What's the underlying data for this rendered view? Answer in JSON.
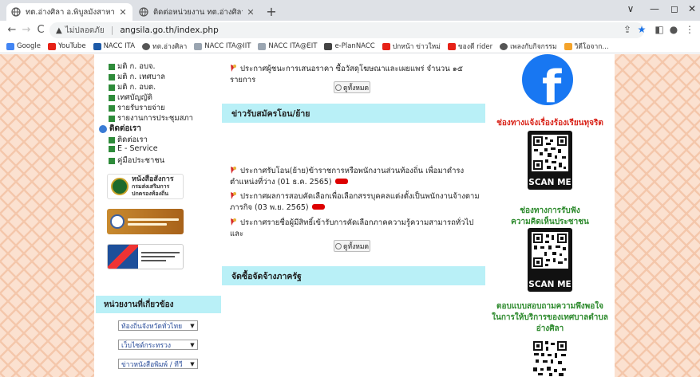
{
  "browser": {
    "tabs": [
      {
        "title": "ทต.อ่างศิลา อ.พิบูลมังสาหาร จ.อุบลราชธานี",
        "active": true
      },
      {
        "title": "ติดต่อหน่วยงาน ทต.อ่างศิลา อ.พิบูลมังสาหาร",
        "active": false
      }
    ],
    "new_tab": "+",
    "window_controls": {
      "minimize": "—",
      "maximize": "◻",
      "close": "✕",
      "menu": "∨"
    },
    "nav": {
      "back": "←",
      "forward": "→",
      "reload": "C"
    },
    "address": {
      "insecure_label": "ไม่ปลอดภัย",
      "separator": "|",
      "url": "angsila.go.th/index.php"
    },
    "bookmarks": [
      {
        "label": "Google",
        "color": "#4285f4"
      },
      {
        "label": "YouTube",
        "color": "#e62117"
      },
      {
        "label": "NACC ITA",
        "color": "#1d5aa8"
      },
      {
        "label": "ทต.อ่างศิลา",
        "color": "#555555"
      },
      {
        "label": "NACC ITA@IIT",
        "color": "#9aa5b1"
      },
      {
        "label": "NACC ITA@EIT",
        "color": "#9aa5b1"
      },
      {
        "label": "e-PlanNACC",
        "color": "#444444"
      },
      {
        "label": "ปกหน้า ข่าวใหม่",
        "color": "#e62117"
      },
      {
        "label": "ของดี rider",
        "color": "#e62117"
      },
      {
        "label": "เพลงกับกิจกรรม",
        "color": "#555555"
      },
      {
        "label": "วิดีโอจาก...",
        "color": "#f4a32a"
      }
    ]
  },
  "left_menu": {
    "items_top": [
      "มติ ก. อบจ.",
      "มติ ก. เทศบาล",
      "มติ ก. อบต.",
      "เทศบัญญัติ",
      "รายรับรายจ่าย",
      "รายงานการประชุมสภา"
    ],
    "contact_head": "ติดต่อเรา",
    "contact_items": [
      "ติดต่อเรา",
      "E - Service",
      "คู่มือประชาชน"
    ],
    "banner1": {
      "title": "หนังสือสั่งการ",
      "subtitle": "กรมส่งเสริมการปกครองท้องถิ่น"
    },
    "agency_head": "หน่วยงานที่เกี่ยวข้อง",
    "selects": [
      "ท้องถิ่นจังหวัดทั่วไทย",
      "เว็บไซต์กระทรวง",
      "ข่าวหนังสือพิมพ์ / ทีวี"
    ]
  },
  "middle": {
    "top_news": "ประกาศผู้ชนะการเสนอราคา ซื้อวัสดุโฆษณาและเผยแพร่ จำนวน ๑๕ รายการ",
    "see_all": "ดูทั้งหมด",
    "transfer_head": "ข่าวรับสมัครโอน/ย้าย",
    "transfer_news": [
      "ประกาศรับโอน(ย้าย)ข้าราชการหรือพนักงานส่วนท้องถิ่น เพื่อมาดำรงตำแหน่งที่ว่าง (01 ธ.ค. 2565)",
      "ประกาศผลการสอบคัดเลือกเพื่อเลือกสรรบุคคลแต่งตั้งเป็นพนักงานจ้างตามภารกิจ (03 พ.ย. 2565)",
      "ประกาศรายชื่อผู้มีสิทธิ์เข้ารับการคัดเลือกภาคความรู้ความสามารถทั่วไปและ"
    ],
    "procurement_head": "จัดซื้อจัดจ้างภาครัฐ"
  },
  "right": {
    "fb_letter": "f",
    "corruption_link": "ช่องทางแจ้งเรื่องร้องเรียนทุจริต",
    "scan_me": "SCAN ME",
    "opinion_link_line1": "ช่องทางการรับฟัง",
    "opinion_link_line2": "ความคิดเห็นประชาชน",
    "survey_line1": "ตอบแบบสอบถามความพึงพอใจ",
    "survey_line2": "ในการให้บริการของเทศบาลตำบล",
    "survey_line3": "อ่างศิลา"
  },
  "colors": {
    "section_head": "#b9f0f7",
    "red_link": "#d9261c",
    "green_link": "#2d8a2d",
    "facebook": "#1877f2",
    "new_badge": "#dd0000"
  }
}
